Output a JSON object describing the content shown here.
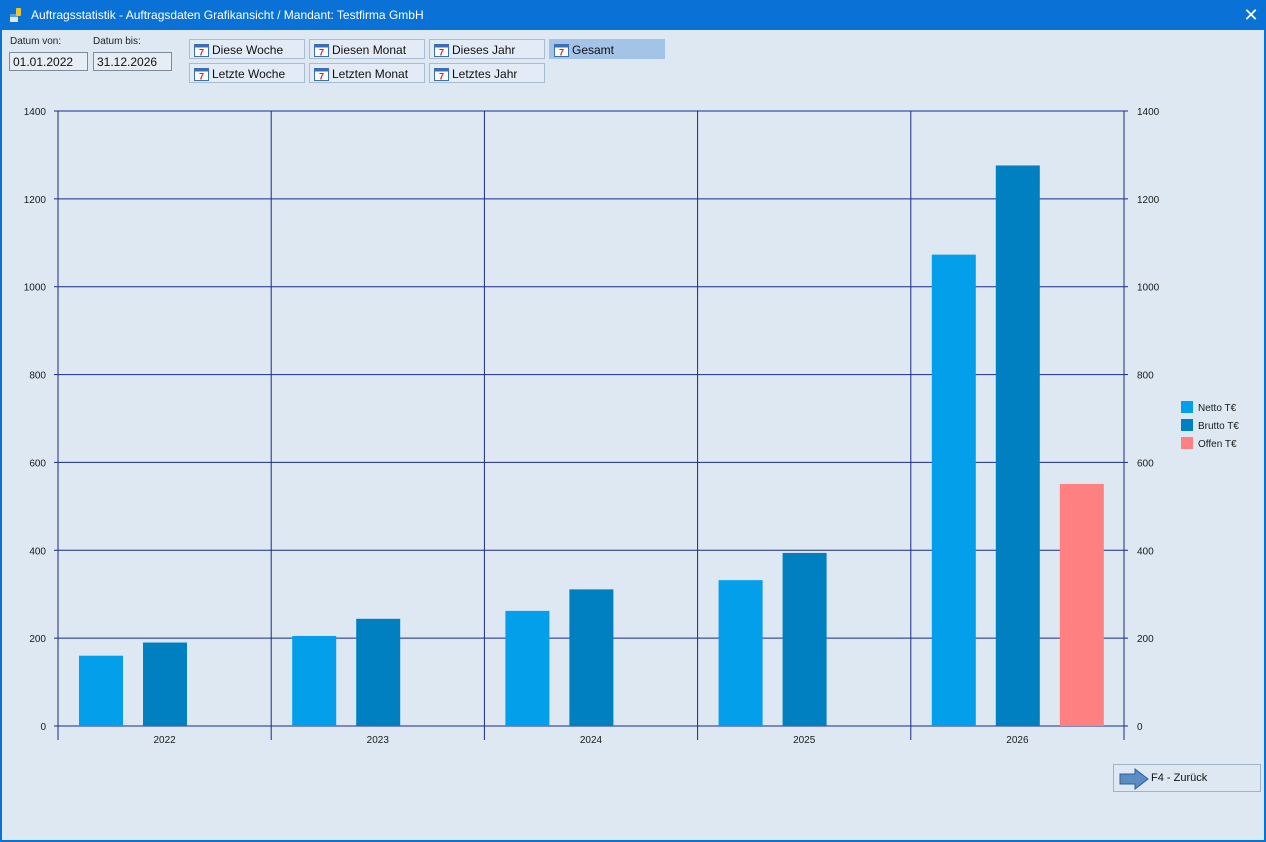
{
  "window": {
    "title": "Auftragsstatistik - Auftragsdaten Grafikansicht / Mandant: Testfirma GmbH",
    "close_symbol": "✕"
  },
  "filters": {
    "date_from_label": "Datum von:",
    "date_from_value": "01.01.2022",
    "date_to_label": "Datum bis:",
    "date_to_value": "31.12.2026"
  },
  "range_buttons": [
    {
      "label": "Diese Woche",
      "icon": "calendar-icon",
      "active": false
    },
    {
      "label": "Diesen Monat",
      "icon": "calendar-icon",
      "active": false
    },
    {
      "label": "Dieses Jahr",
      "icon": "calendar-icon",
      "active": false
    },
    {
      "label": "Gesamt",
      "icon": "calendar-icon",
      "active": true
    },
    {
      "label": "Letzte Woche",
      "icon": "calendar-icon",
      "active": false
    },
    {
      "label": "Letzten Monat",
      "icon": "calendar-icon",
      "active": false
    },
    {
      "label": "Letztes Jahr",
      "icon": "calendar-icon",
      "active": false
    }
  ],
  "footer": {
    "back_label": "F4 - Zurück",
    "back_icon": "arrow-right-icon"
  },
  "colors": {
    "titlebar": "#0a72d6",
    "grid": "#1a2a8a",
    "netto": "#049fea",
    "brutto": "#007fc1",
    "offen": "#ff8080"
  },
  "chart_data": {
    "type": "bar",
    "categories": [
      "2022",
      "2023",
      "2024",
      "2025",
      "2026"
    ],
    "series": [
      {
        "name": "Netto T€",
        "values": [
          160,
          205,
          262,
          332,
          1073
        ]
      },
      {
        "name": "Brutto T€",
        "values": [
          190,
          244,
          311,
          394,
          1276
        ]
      },
      {
        "name": "Offen T€",
        "values": [
          0,
          0,
          0,
          0,
          551
        ]
      }
    ],
    "ylim": [
      0,
      1400
    ],
    "yticks": [
      "0",
      "200",
      "400",
      "600",
      "800",
      "1000",
      "1200",
      "1400"
    ],
    "grid": true,
    "legend": "right",
    "secondary_y_axis": true
  }
}
